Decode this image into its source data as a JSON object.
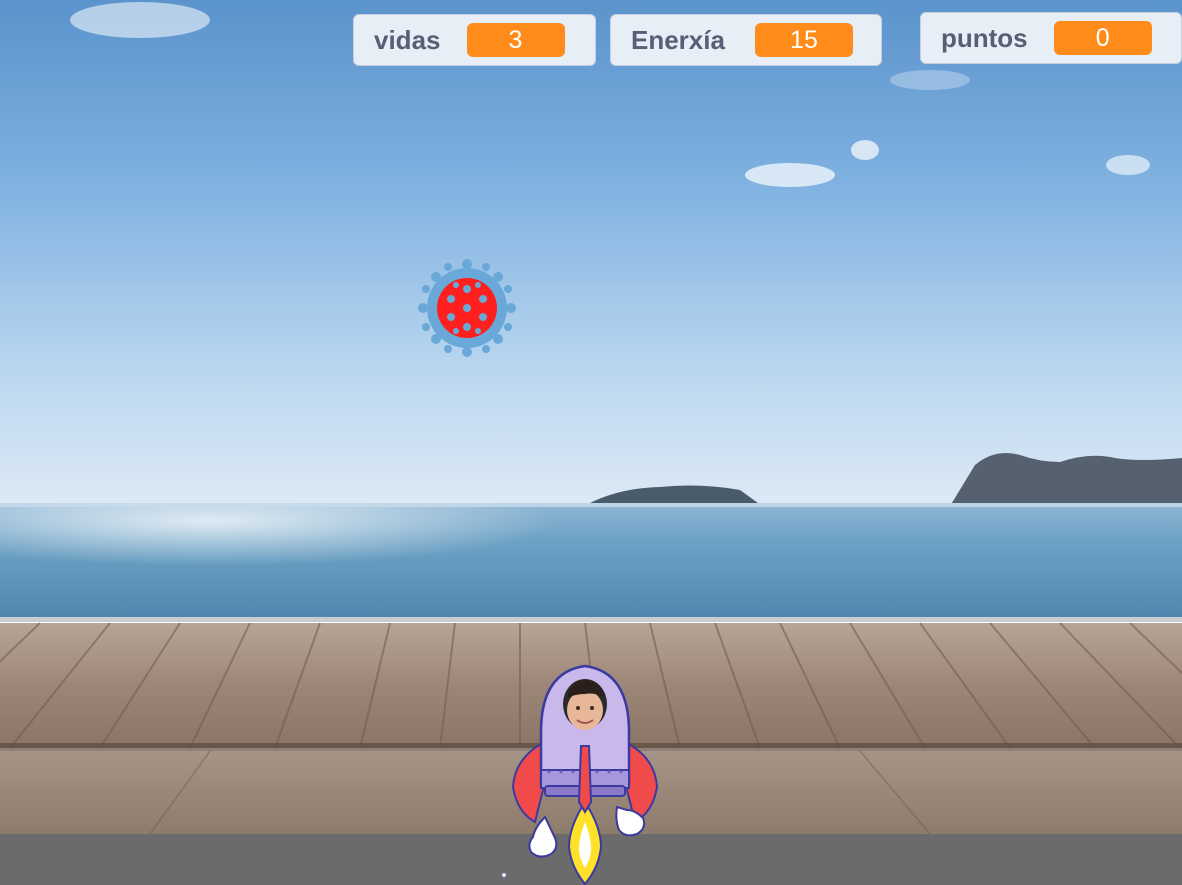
{
  "monitors": {
    "vidas": {
      "label": "vidas",
      "value": "3"
    },
    "enerxia": {
      "label": "Enerxía",
      "value": "15"
    },
    "puntos": {
      "label": "puntos",
      "value": "0"
    }
  },
  "sprites": {
    "virus": {
      "icon": "virus-icon",
      "color": "#ff1f1f"
    },
    "rocket": {
      "icon": "rocket-icon",
      "color": "#c9b8ec"
    }
  },
  "colors": {
    "monitor_value": "#ff8c1a",
    "monitor_label": "#575e75",
    "monitor_bg": "#e8eef6"
  }
}
